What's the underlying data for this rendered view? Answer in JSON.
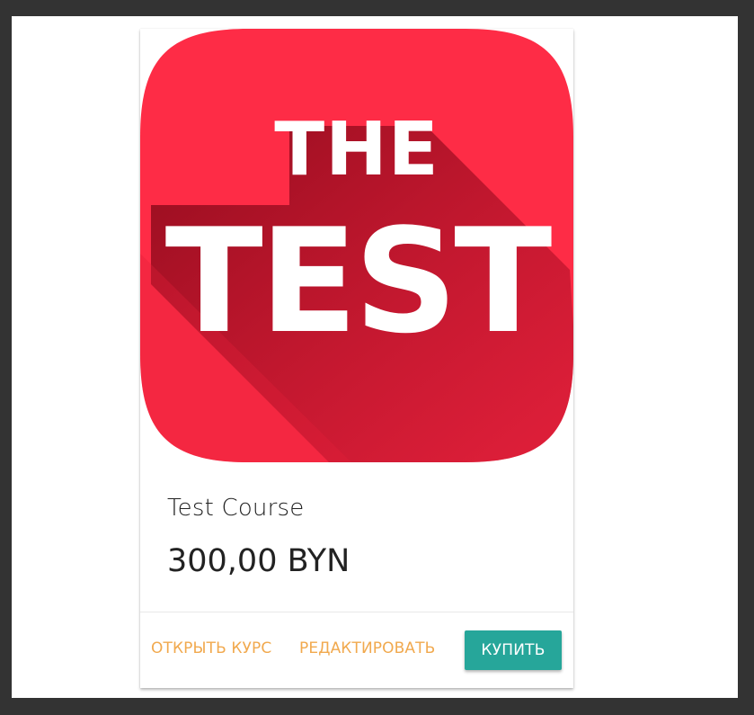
{
  "course": {
    "image_line1": "THE",
    "image_line2": "TEST",
    "title": "Test Course",
    "price": "300,00 BYN"
  },
  "actions": {
    "open_label": "ОТКРЫТЬ КУРС",
    "edit_label": "РЕДАКТИРОВАТЬ",
    "buy_label": "КУПИТЬ"
  },
  "colors": {
    "background": "#333333",
    "page": "#ffffff",
    "logo_red": "#fe2c46",
    "logo_shadow": "#a50f22",
    "link_orange": "#f1a94e",
    "buy_teal": "#26a69a"
  }
}
